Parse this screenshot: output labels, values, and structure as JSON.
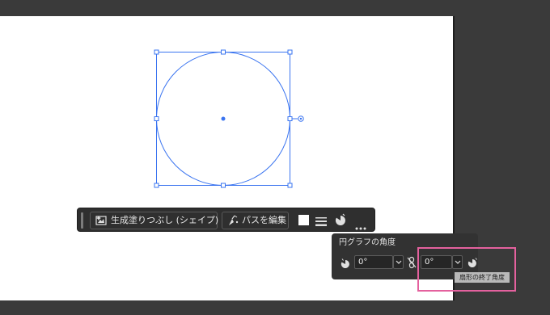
{
  "taskbar": {
    "generative_fill_label": "生成塗りつぶし (シェイプ)",
    "edit_path_label": "パスを編集",
    "icons": [
      "generative-fill-icon",
      "edit-path-icon",
      "fill-swatch",
      "stroke-icon",
      "pie-angle-icon",
      "more-icon"
    ]
  },
  "pie_panel": {
    "title": "円グラフの角度",
    "start_angle": "0°",
    "end_angle": "0°",
    "tooltip": "扇形の終了角度"
  },
  "colors": {
    "selection": "#3a74f0",
    "highlight": "#e4619e",
    "panel_bg": "#323232",
    "canvas": "#ffffff"
  }
}
